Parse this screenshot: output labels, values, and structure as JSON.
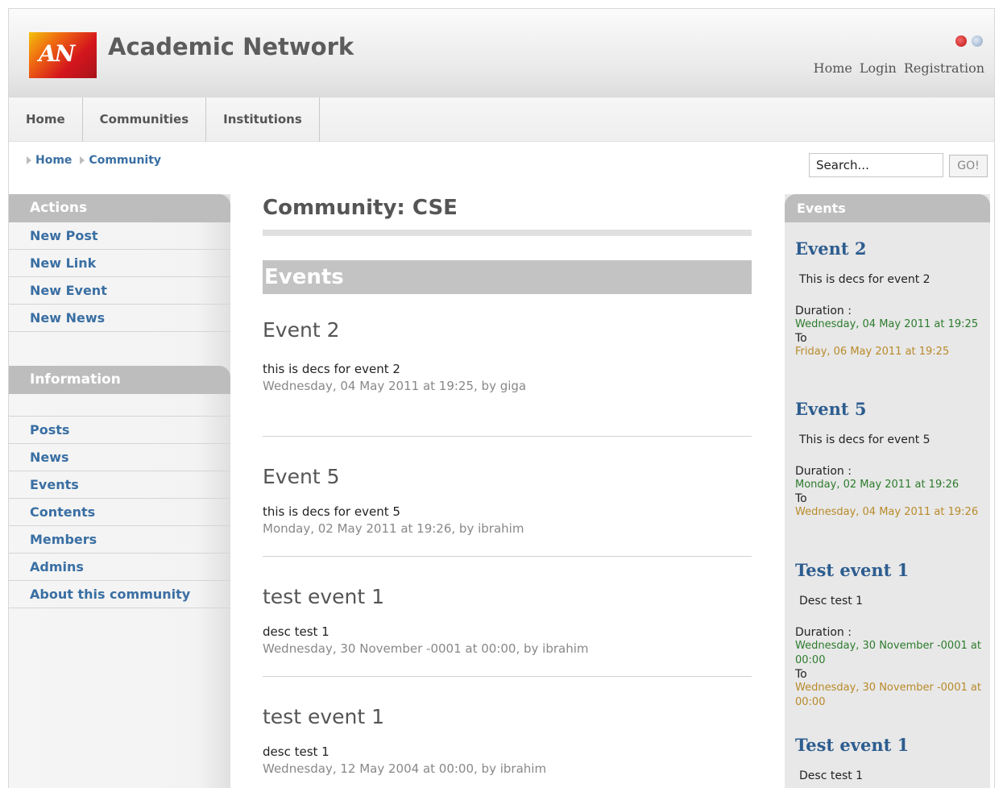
{
  "site": {
    "logo_text": "AN",
    "title": "Academic Network"
  },
  "top_links": [
    "Home",
    "Login",
    "Registration"
  ],
  "main_nav": [
    "Home",
    "Communities",
    "Institutions"
  ],
  "breadcrumb": [
    "Home",
    "Community"
  ],
  "search": {
    "value": "Search...",
    "button": "GO!"
  },
  "sidebar": {
    "actions_title": "Actions",
    "actions": [
      "New Post",
      "New Link",
      "New Event",
      "New News"
    ],
    "info_title": "Information",
    "info": [
      "Posts",
      "News",
      "Events",
      "Contents",
      "Members",
      "Admins",
      "About this community"
    ]
  },
  "main": {
    "title": "Community: CSE",
    "section_title": "Events",
    "events": [
      {
        "title": "Event 2",
        "desc": "this is decs for event 2",
        "meta": "Wednesday, 04 May 2011 at 19:25, by giga"
      },
      {
        "title": "Event 5",
        "desc": "this is decs for event 5",
        "meta": "Monday, 02 May 2011 at 19:26, by ibrahim"
      },
      {
        "title": "test event 1",
        "desc": "desc test 1",
        "meta": "Wednesday, 30 November -0001 at 00:00, by ibrahim"
      },
      {
        "title": "test event 1",
        "desc": "desc test 1",
        "meta": "Wednesday, 12 May 2004 at 00:00, by ibrahim"
      }
    ]
  },
  "right": {
    "title": "Events",
    "duration_label": "Duration :",
    "to_label": "To",
    "events": [
      {
        "title": "Event 2",
        "desc": "This is decs for event 2",
        "from": "Wednesday, 04 May 2011 at 19:25",
        "to": "Friday, 06 May 2011 at 19:25"
      },
      {
        "title": "Event 5",
        "desc": "This is decs for event 5",
        "from": "Monday, 02 May 2011 at 19:26",
        "to": "Wednesday, 04 May 2011 at 19:26"
      },
      {
        "title": "Test event 1",
        "desc": "Desc test 1",
        "from": "Wednesday, 30 November -0001 at 00:00",
        "to": "Wednesday, 30 November -0001 at 00:00"
      },
      {
        "title": "Test event 1",
        "desc": "Desc test 1"
      }
    ]
  },
  "colors": {
    "link": "#3a6fa3",
    "from_date": "#2d7b2d",
    "to_date": "#b88a2a",
    "header_bar": "#bdbdbd"
  }
}
